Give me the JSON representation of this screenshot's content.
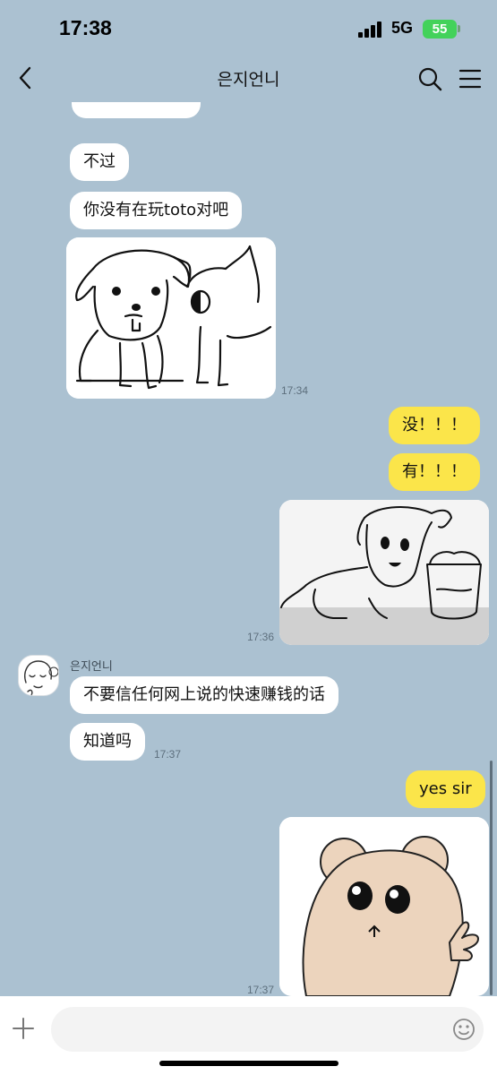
{
  "status_bar": {
    "time": "17:38",
    "network": "5G",
    "battery": "55"
  },
  "header": {
    "title": "은지언니"
  },
  "messages": {
    "m1": "不过",
    "m2": "你没有在玩toto对吧",
    "t1": "17:34",
    "m3": "没！！！",
    "m4": "有！！！",
    "t2": "17:36",
    "sender": "은지언니",
    "m5": "不要信任何网上说的快速赚钱的话",
    "m6": "知道吗",
    "t3": "17:37",
    "m7": "yes sir",
    "t4": "17:37"
  },
  "input": {
    "placeholder": ""
  },
  "colors": {
    "background": "#abc1d1",
    "outgoing_bubble": "#fbe54a",
    "incoming_bubble": "#ffffff",
    "battery": "#43d25a"
  }
}
